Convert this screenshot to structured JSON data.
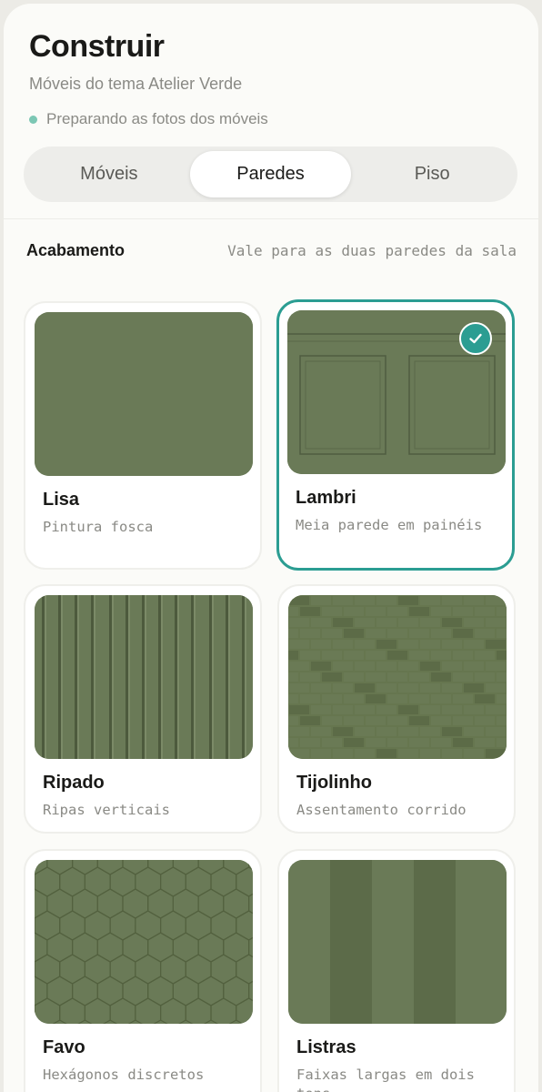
{
  "header": {
    "title": "Construir",
    "subtitle": "Móveis do tema Atelier Verde",
    "status": "Preparando as fotos dos móveis",
    "status_color": "#7cc7b4"
  },
  "tabs": [
    {
      "label": "Móveis",
      "active": false
    },
    {
      "label": "Paredes",
      "active": true
    },
    {
      "label": "Piso",
      "active": false
    }
  ],
  "section": {
    "label": "Acabamento",
    "hint": "Vale para as duas paredes da sala"
  },
  "finishes": [
    {
      "name": "Lisa",
      "desc": "Pintura fosca",
      "selected": false,
      "pattern": "plain"
    },
    {
      "name": "Lambri",
      "desc": "Meia parede em painéis",
      "selected": true,
      "pattern": "panels"
    },
    {
      "name": "Ripado",
      "desc": "Ripas verticais",
      "selected": false,
      "pattern": "slats"
    },
    {
      "name": "Tijolinho",
      "desc": "Assentamento corrido",
      "selected": false,
      "pattern": "brick"
    },
    {
      "name": "Favo",
      "desc": "Hexágonos discretos",
      "selected": false,
      "pattern": "hexagon"
    },
    {
      "name": "Listras",
      "desc": "Faixas largas em dois tons",
      "selected": false,
      "pattern": "stripes"
    }
  ],
  "colors": {
    "wall_green": "#6a7a57",
    "accent": "#2b9d92"
  },
  "icons": {
    "selected_check": "check-icon"
  }
}
